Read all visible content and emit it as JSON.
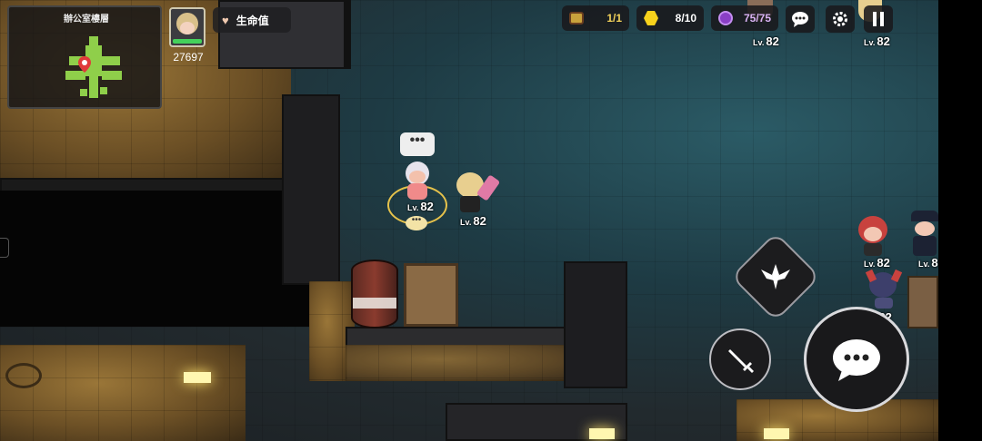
{
  "minimap": {
    "title": "辦公室樓層"
  },
  "player": {
    "power": "27697"
  },
  "hud": {
    "life_label": "生命值"
  },
  "resources": [
    {
      "icon": "treasure-chest-icon",
      "value": "1/1",
      "color": "#f2d15a"
    },
    {
      "icon": "gold-hexagon-icon",
      "value": "8/10",
      "color": "#f7d21c"
    },
    {
      "icon": "purple-stamina-icon",
      "value": "75/75",
      "color": "#b562e8"
    }
  ],
  "characters": [
    {
      "level": "82"
    },
    {
      "level": "82"
    },
    {
      "level": "82"
    },
    {
      "level": "82"
    },
    {
      "level": "82"
    },
    {
      "level": "8"
    },
    {
      "level": "82"
    },
    {
      "level": "82"
    }
  ],
  "lv_prefix": "Lv.",
  "colors": {
    "accent_gold": "#e6c24b",
    "hp_green": "#44d15b"
  }
}
